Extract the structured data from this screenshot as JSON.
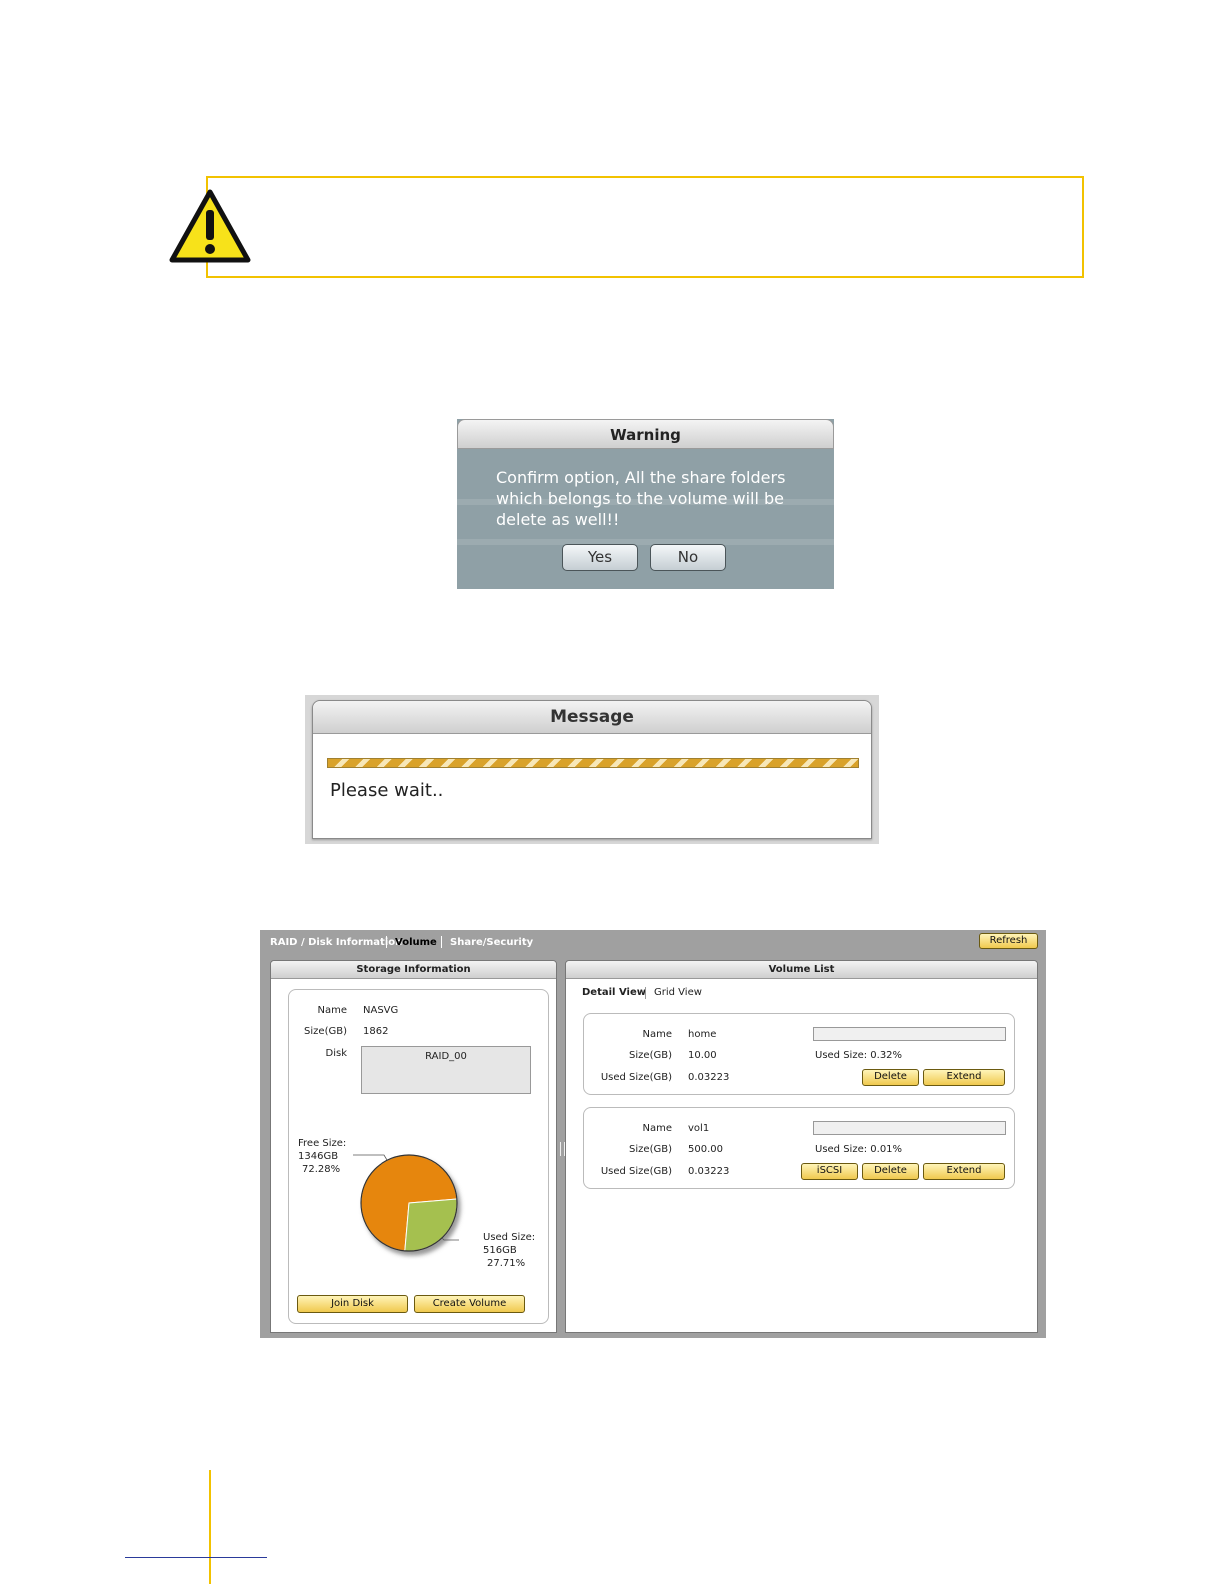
{
  "warning_dialog": {
    "title": "Warning",
    "message": "Confirm option, All the share folders which belongs to the volume will be delete as well!!",
    "yes_label": "Yes",
    "no_label": "No"
  },
  "message_dialog": {
    "title": "Message",
    "text": "Please wait.."
  },
  "nas": {
    "tabs": [
      "RAID / Disk Information",
      "Volume",
      "Share/Security"
    ],
    "refresh_label": "Refresh",
    "storage": {
      "title": "Storage Information",
      "name_label": "Name",
      "name_value": "NASVG",
      "size_label": "Size(GB)",
      "size_value": "1862",
      "disk_label": "Disk",
      "disk_value": "RAID_00",
      "free_label": "Free Size:",
      "free_gb": "1346GB",
      "free_pct": "72.28%",
      "used_label": "Used Size:",
      "used_gb": "516GB",
      "used_pct": "27.71%",
      "join_disk_label": "Join Disk",
      "create_volume_label": "Create Volume"
    },
    "volume_list": {
      "title": "Volume List",
      "detail_view": "Detail View",
      "grid_view": "Grid View",
      "name_label": "Name",
      "size_label": "Size(GB)",
      "used_label": "Used Size(GB)",
      "iscsi_label": "iSCSI",
      "delete_label": "Delete",
      "extend_label": "Extend",
      "volumes": [
        {
          "name": "home",
          "size": "10.00",
          "used": "0.03223",
          "used_pct_text": "Used Size: 0.32%"
        },
        {
          "name": "vol1",
          "size": "500.00",
          "used": "0.03223",
          "used_pct_text": "Used Size: 0.01%"
        }
      ]
    }
  },
  "chart_data": {
    "type": "pie",
    "categories": [
      "Free Size",
      "Used Size"
    ],
    "values": [
      72.28,
      27.71
    ],
    "colors": [
      "#e6860a",
      "#a5c04f"
    ]
  }
}
